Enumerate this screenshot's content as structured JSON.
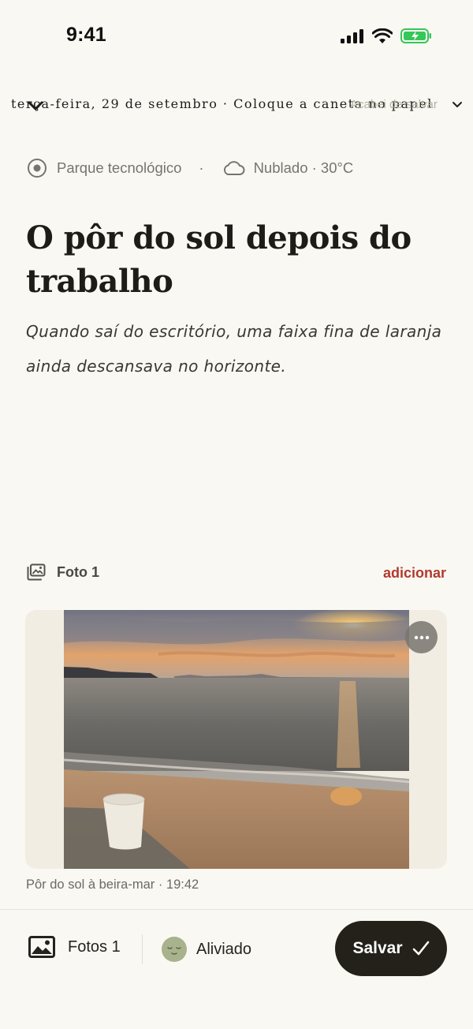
{
  "status_bar": {
    "time": "9:41"
  },
  "header": {
    "date": "terça-feira, 29 de setembro · Coloque a caneta no papel",
    "saved_status": "Acabei de salvar"
  },
  "meta": {
    "location": "Parque tecnológico",
    "separator": "·",
    "weather": "Nublado · 30°C"
  },
  "entry": {
    "title": "O pôr do sol depois do trabalho",
    "body": "Quando saí do escritório, uma faixa fina de laranja ainda descansava no horizonte."
  },
  "photos_section": {
    "label": "Foto 1",
    "add_label": "adicionar",
    "caption": "Pôr do sol à beira-mar · 19:42"
  },
  "toolbar": {
    "photos_label": "Fotos 1",
    "mood_label": "Aliviado",
    "save_label": "Salvar"
  },
  "colors": {
    "background": "#FAF8F3",
    "accent": "#B03A2E",
    "save_button": "#24211B",
    "battery": "#34C759"
  },
  "icons": [
    "chevron-down-icon",
    "signal-icon",
    "wifi-icon",
    "battery-icon",
    "location-icon",
    "cloud-icon",
    "photos-icon",
    "more-icon",
    "image-icon",
    "mood-icon",
    "checkmark-icon"
  ]
}
